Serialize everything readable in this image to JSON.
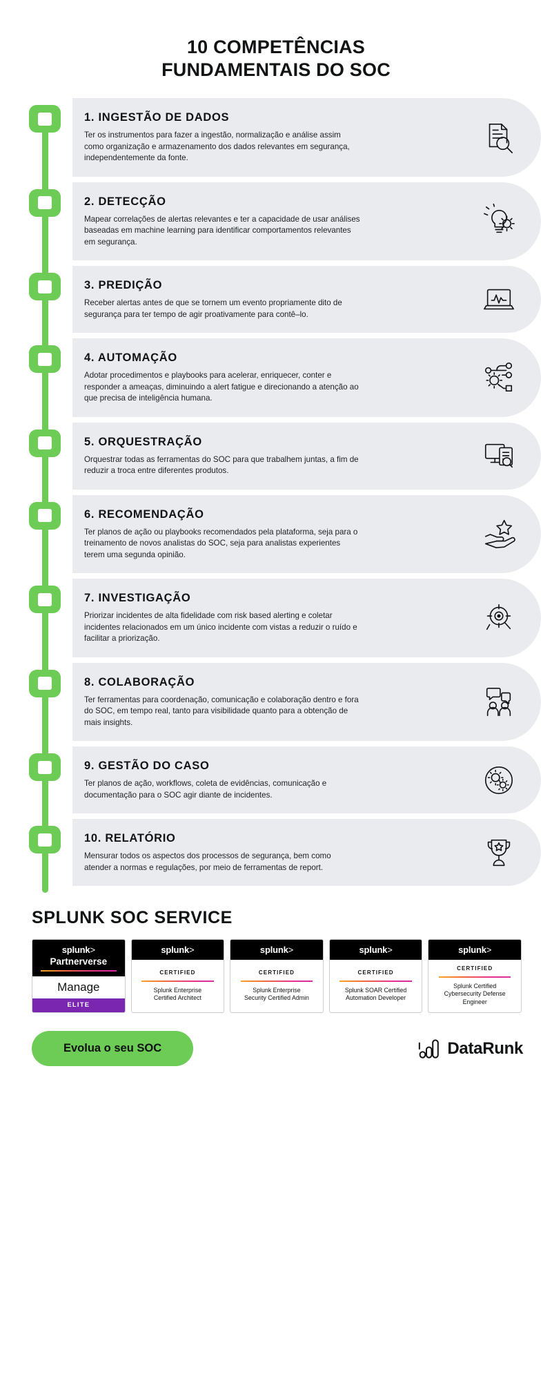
{
  "header": {
    "title_line1": "10 COMPETÊNCIAS",
    "title_line2": "FUNDAMENTAIS DO SOC"
  },
  "competencies": [
    {
      "title": "1. INGESTÃO DE DADOS",
      "body": "Ter os instrumentos para fazer a ingestão, normalização e análise assim como organização e armazenamento dos dados relevantes em segurança, independentemente da fonte.",
      "icon": "document-search-icon"
    },
    {
      "title": "2. DETECÇÃO",
      "body": "Mapear correlações de alertas relevantes e ter a capacidade de usar análises baseadas em machine learning para identificar comportamentos relevantes em segurança.",
      "icon": "lightbulb-gear-icon"
    },
    {
      "title": "3. PREDIÇÃO",
      "body": "Receber alertas antes de que se tornem um evento propriamente dito de segurança para ter tempo de agir proativamente para contê–lo.",
      "icon": "laptop-chart-icon"
    },
    {
      "title": "4. AUTOMAÇÃO",
      "body": "Adotar procedimentos e playbooks para acelerar, enriquecer, conter e responder a ameaças, diminuindo a alert fatigue e direcionando a atenção ao que precisa de inteligência humana.",
      "icon": "workflow-gear-icon"
    },
    {
      "title": "5. ORQUESTRAÇÃO",
      "body": "Orquestrar todas as ferramentas do SOC para que trabalhem juntas, a fim de reduzir a troca entre diferentes produtos.",
      "icon": "monitor-checklist-icon"
    },
    {
      "title": "6. RECOMENDAÇÃO",
      "body": "Ter planos de ação ou playbooks recomendados pela plataforma, seja para o treinamento de novos analistas do SOC, seja para analistas experientes terem uma segunda opinião.",
      "icon": "hand-star-icon"
    },
    {
      "title": "7. INVESTIGAÇÃO",
      "body": "Priorizar incidentes de alta fidelidade com risk based alerting e coletar incidentes relacionados em um único incidente com vistas a reduzir o ruído e facilitar a priorização.",
      "icon": "target-magnifier-icon"
    },
    {
      "title": "8. COLABORAÇÃO",
      "body": "Ter ferramentas para coordenação, comunicação e colaboração dentro e fora do SOC, em tempo real, tanto para visibilidade quanto para a obtenção de mais insights.",
      "icon": "people-chat-icon"
    },
    {
      "title": "9. GESTÃO DO CASO",
      "body": "Ter planos de ação, workflows, coleta de evidências, comunicação e documentação para o SOC agir diante de incidentes.",
      "icon": "gears-circle-icon"
    },
    {
      "title": "10. RELATÓRIO",
      "body": "Mensurar todos os aspectos dos processos de segurança, bem como atender a normas e regulações, por meio de ferramentas de report.",
      "icon": "trophy-star-icon"
    }
  ],
  "splunk": {
    "section_title": "SPLUNK SOC SERVICE",
    "badges": [
      {
        "type": "partnerverse",
        "brand": "splunk",
        "brand_suffix": ">",
        "program": "Partnerverse",
        "level_label": "Manage",
        "tier": "ELITE"
      },
      {
        "type": "certification",
        "brand": "splunk",
        "brand_suffix": ">",
        "certified_label": "CERTIFIED",
        "name_line1": "Splunk Enterprise",
        "name_line2": "Certified Architect"
      },
      {
        "type": "certification",
        "brand": "splunk",
        "brand_suffix": ">",
        "certified_label": "CERTIFIED",
        "name_line1": "Splunk Enterprise",
        "name_line2": "Security Certified Admin"
      },
      {
        "type": "certification",
        "brand": "splunk",
        "brand_suffix": ">",
        "certified_label": "CERTIFIED",
        "name_line1": "Splunk SOAR Certified",
        "name_line2": "Automation Developer"
      },
      {
        "type": "certification",
        "brand": "splunk",
        "brand_suffix": ">",
        "certified_label": "CERTIFIED",
        "name_line1": "Splunk Certified",
        "name_line2": "Cybersecurity Defense",
        "name_line3": "Engineer"
      }
    ]
  },
  "footer": {
    "cta_label": "Evolua o seu SOC",
    "brand_name": "DataRunk"
  },
  "colors": {
    "green": "#6dcc55",
    "card_bg": "#e9ebee",
    "ink": "#111315",
    "elite_purple": "#7a26b0"
  }
}
